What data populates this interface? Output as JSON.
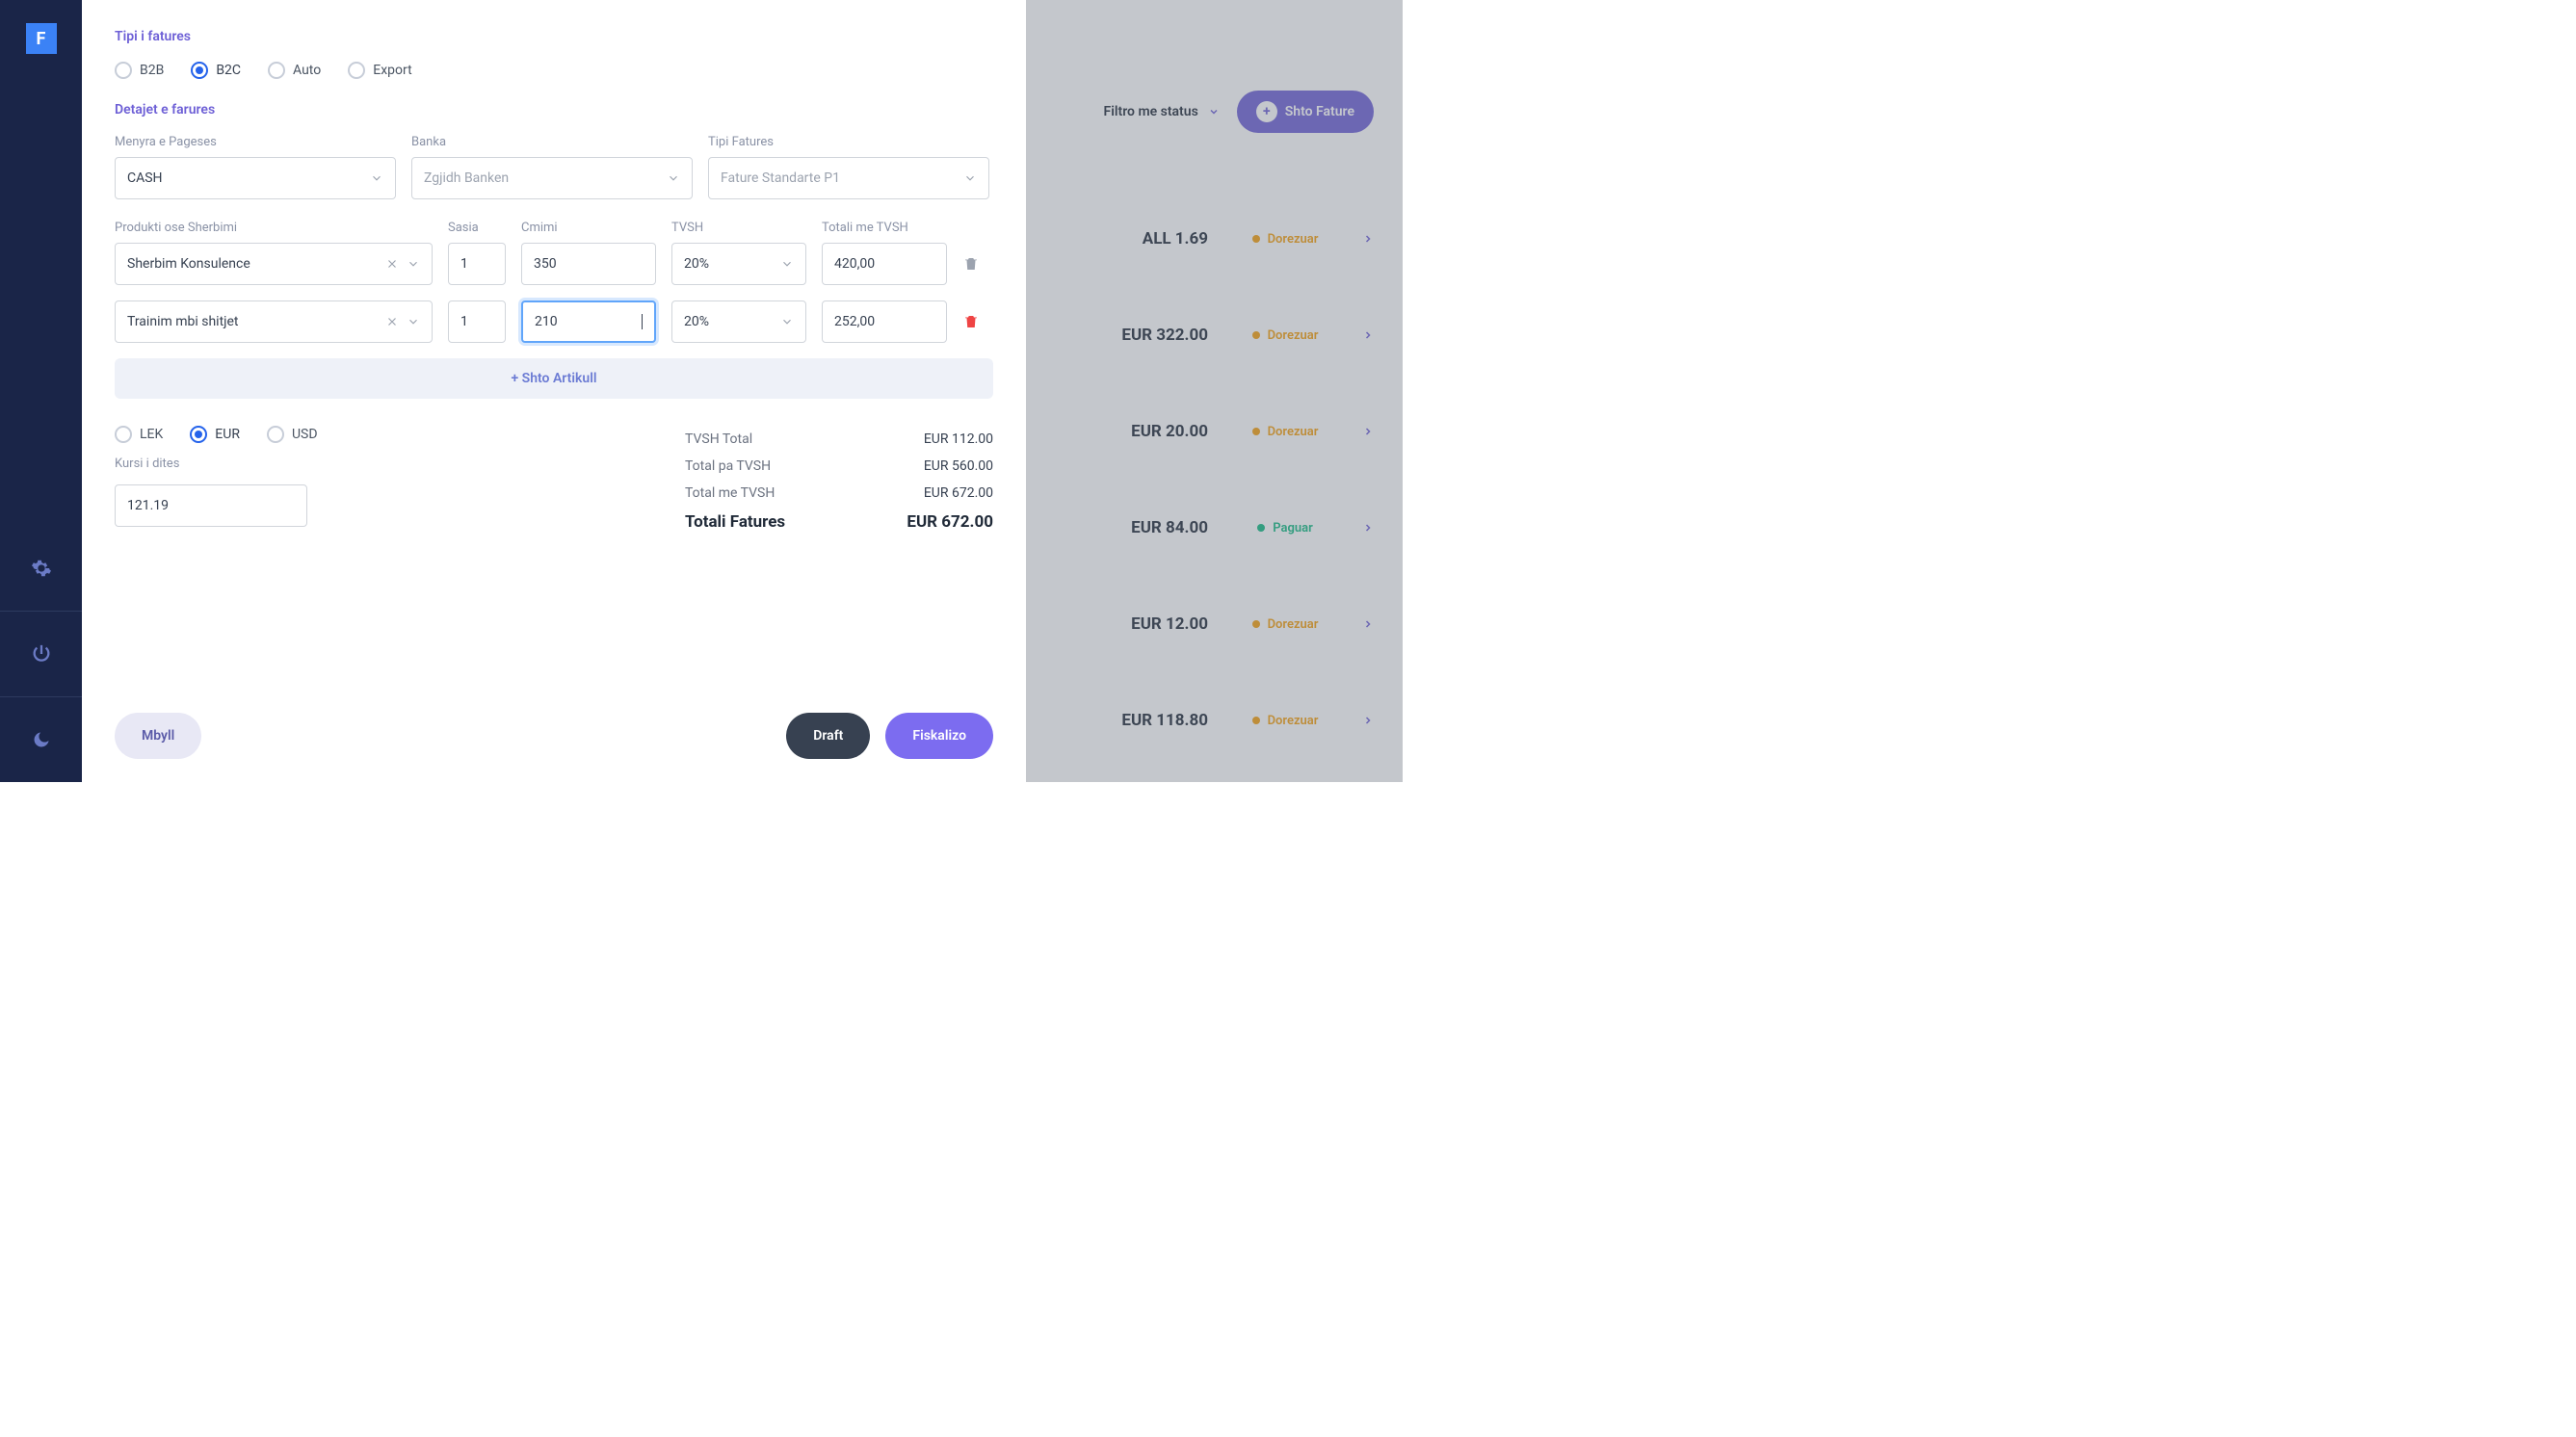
{
  "sidebar": {
    "logo": "F"
  },
  "modal": {
    "type_title": "Tipi i fatures",
    "types": [
      "B2B",
      "B2C",
      "Auto",
      "Export"
    ],
    "type_selected": 1,
    "details_title": "Detajet e farures",
    "payment_label": "Menyra e Pageses",
    "payment_value": "CASH",
    "bank_label": "Banka",
    "bank_placeholder": "Zgjidh Banken",
    "inv_type_label": "Tipi Fatures",
    "inv_type_value": "Fature Standarte P1",
    "columns": {
      "product": "Produkti ose Sherbimi",
      "qty": "Sasia",
      "price": "Cmimi",
      "vat": "TVSH",
      "total": "Totali me TVSH"
    },
    "lines": [
      {
        "product": "Sherbim Konsulence",
        "qty": "1",
        "price": "350",
        "vat": "20%",
        "total": "420,00",
        "delete_active": false
      },
      {
        "product": "Trainim mbi shitjet",
        "qty": "1",
        "price": "210",
        "vat": "20%",
        "total": "252,00",
        "delete_active": true,
        "focused": true
      }
    ],
    "add_article": "+ Shto Artikull",
    "currencies": [
      "LEK",
      "EUR",
      "USD"
    ],
    "currency_selected": 1,
    "rate_label": "Kursi i dites",
    "rate_value": "121.19",
    "totals": [
      {
        "label": "TVSH Total",
        "value": "EUR 112.00"
      },
      {
        "label": "Total pa TVSH",
        "value": "EUR 560.00"
      },
      {
        "label": "Total me TVSH",
        "value": "EUR 672.00"
      }
    ],
    "grand": {
      "label": "Totali Fatures",
      "value": "EUR 672.00"
    },
    "close_btn": "Mbyll",
    "draft_btn": "Draft",
    "submit_btn": "Fiskalizo"
  },
  "background": {
    "filter_label": "Filtro me status",
    "add_label": "Shto Fature",
    "rows": [
      {
        "amount": "ALL 1.69",
        "status": "Dorezuar",
        "style": "orange"
      },
      {
        "amount": "EUR 322.00",
        "status": "Dorezuar",
        "style": "orange"
      },
      {
        "amount": "EUR 20.00",
        "status": "Dorezuar",
        "style": "orange"
      },
      {
        "amount": "EUR 84.00",
        "status": "Paguar",
        "style": "green"
      },
      {
        "amount": "EUR 12.00",
        "status": "Dorezuar",
        "style": "orange"
      },
      {
        "amount": "EUR 118.80",
        "status": "Dorezuar",
        "style": "orange"
      }
    ]
  }
}
